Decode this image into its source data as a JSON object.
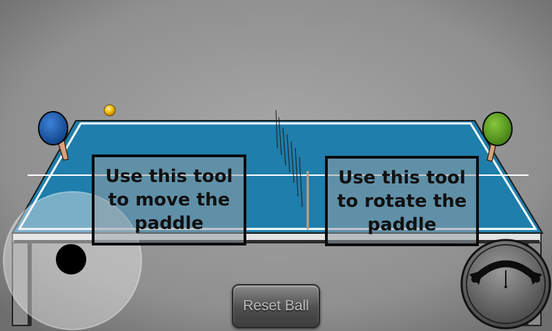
{
  "game": {
    "move_tool_hint": "Use this tool\nto move the\npaddle",
    "rotate_tool_hint": "Use this tool\nto rotate the\npaddle",
    "reset_button_label": "Reset Ball"
  },
  "colors": {
    "background": "#8e8e8e",
    "table_top": "#1f7eab",
    "table_line": "#ffffff",
    "table_edge": "#e4e4e4",
    "player_paddle": "#1a5da8",
    "opponent_paddle": "#5c9a1e",
    "paddle_handle": "#d9a27c",
    "ball": "#f0b400"
  },
  "icons": {
    "move_joystick": "joystick-icon",
    "rotate_dial": "rotate-arrow-icon",
    "ball": "ball-icon"
  }
}
